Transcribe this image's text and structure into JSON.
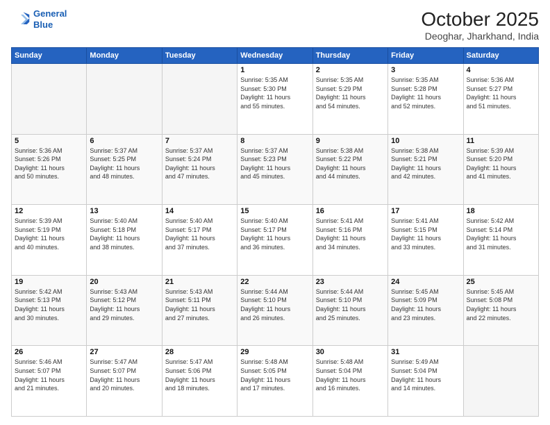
{
  "header": {
    "logo_line1": "General",
    "logo_line2": "Blue",
    "month": "October 2025",
    "location": "Deoghar, Jharkhand, India"
  },
  "weekdays": [
    "Sunday",
    "Monday",
    "Tuesday",
    "Wednesday",
    "Thursday",
    "Friday",
    "Saturday"
  ],
  "weeks": [
    [
      {
        "day": "",
        "info": ""
      },
      {
        "day": "",
        "info": ""
      },
      {
        "day": "",
        "info": ""
      },
      {
        "day": "1",
        "info": "Sunrise: 5:35 AM\nSunset: 5:30 PM\nDaylight: 11 hours\nand 55 minutes."
      },
      {
        "day": "2",
        "info": "Sunrise: 5:35 AM\nSunset: 5:29 PM\nDaylight: 11 hours\nand 54 minutes."
      },
      {
        "day": "3",
        "info": "Sunrise: 5:35 AM\nSunset: 5:28 PM\nDaylight: 11 hours\nand 52 minutes."
      },
      {
        "day": "4",
        "info": "Sunrise: 5:36 AM\nSunset: 5:27 PM\nDaylight: 11 hours\nand 51 minutes."
      }
    ],
    [
      {
        "day": "5",
        "info": "Sunrise: 5:36 AM\nSunset: 5:26 PM\nDaylight: 11 hours\nand 50 minutes."
      },
      {
        "day": "6",
        "info": "Sunrise: 5:37 AM\nSunset: 5:25 PM\nDaylight: 11 hours\nand 48 minutes."
      },
      {
        "day": "7",
        "info": "Sunrise: 5:37 AM\nSunset: 5:24 PM\nDaylight: 11 hours\nand 47 minutes."
      },
      {
        "day": "8",
        "info": "Sunrise: 5:37 AM\nSunset: 5:23 PM\nDaylight: 11 hours\nand 45 minutes."
      },
      {
        "day": "9",
        "info": "Sunrise: 5:38 AM\nSunset: 5:22 PM\nDaylight: 11 hours\nand 44 minutes."
      },
      {
        "day": "10",
        "info": "Sunrise: 5:38 AM\nSunset: 5:21 PM\nDaylight: 11 hours\nand 42 minutes."
      },
      {
        "day": "11",
        "info": "Sunrise: 5:39 AM\nSunset: 5:20 PM\nDaylight: 11 hours\nand 41 minutes."
      }
    ],
    [
      {
        "day": "12",
        "info": "Sunrise: 5:39 AM\nSunset: 5:19 PM\nDaylight: 11 hours\nand 40 minutes."
      },
      {
        "day": "13",
        "info": "Sunrise: 5:40 AM\nSunset: 5:18 PM\nDaylight: 11 hours\nand 38 minutes."
      },
      {
        "day": "14",
        "info": "Sunrise: 5:40 AM\nSunset: 5:17 PM\nDaylight: 11 hours\nand 37 minutes."
      },
      {
        "day": "15",
        "info": "Sunrise: 5:40 AM\nSunset: 5:17 PM\nDaylight: 11 hours\nand 36 minutes."
      },
      {
        "day": "16",
        "info": "Sunrise: 5:41 AM\nSunset: 5:16 PM\nDaylight: 11 hours\nand 34 minutes."
      },
      {
        "day": "17",
        "info": "Sunrise: 5:41 AM\nSunset: 5:15 PM\nDaylight: 11 hours\nand 33 minutes."
      },
      {
        "day": "18",
        "info": "Sunrise: 5:42 AM\nSunset: 5:14 PM\nDaylight: 11 hours\nand 31 minutes."
      }
    ],
    [
      {
        "day": "19",
        "info": "Sunrise: 5:42 AM\nSunset: 5:13 PM\nDaylight: 11 hours\nand 30 minutes."
      },
      {
        "day": "20",
        "info": "Sunrise: 5:43 AM\nSunset: 5:12 PM\nDaylight: 11 hours\nand 29 minutes."
      },
      {
        "day": "21",
        "info": "Sunrise: 5:43 AM\nSunset: 5:11 PM\nDaylight: 11 hours\nand 27 minutes."
      },
      {
        "day": "22",
        "info": "Sunrise: 5:44 AM\nSunset: 5:10 PM\nDaylight: 11 hours\nand 26 minutes."
      },
      {
        "day": "23",
        "info": "Sunrise: 5:44 AM\nSunset: 5:10 PM\nDaylight: 11 hours\nand 25 minutes."
      },
      {
        "day": "24",
        "info": "Sunrise: 5:45 AM\nSunset: 5:09 PM\nDaylight: 11 hours\nand 23 minutes."
      },
      {
        "day": "25",
        "info": "Sunrise: 5:45 AM\nSunset: 5:08 PM\nDaylight: 11 hours\nand 22 minutes."
      }
    ],
    [
      {
        "day": "26",
        "info": "Sunrise: 5:46 AM\nSunset: 5:07 PM\nDaylight: 11 hours\nand 21 minutes."
      },
      {
        "day": "27",
        "info": "Sunrise: 5:47 AM\nSunset: 5:07 PM\nDaylight: 11 hours\nand 20 minutes."
      },
      {
        "day": "28",
        "info": "Sunrise: 5:47 AM\nSunset: 5:06 PM\nDaylight: 11 hours\nand 18 minutes."
      },
      {
        "day": "29",
        "info": "Sunrise: 5:48 AM\nSunset: 5:05 PM\nDaylight: 11 hours\nand 17 minutes."
      },
      {
        "day": "30",
        "info": "Sunrise: 5:48 AM\nSunset: 5:04 PM\nDaylight: 11 hours\nand 16 minutes."
      },
      {
        "day": "31",
        "info": "Sunrise: 5:49 AM\nSunset: 5:04 PM\nDaylight: 11 hours\nand 14 minutes."
      },
      {
        "day": "",
        "info": ""
      }
    ]
  ]
}
